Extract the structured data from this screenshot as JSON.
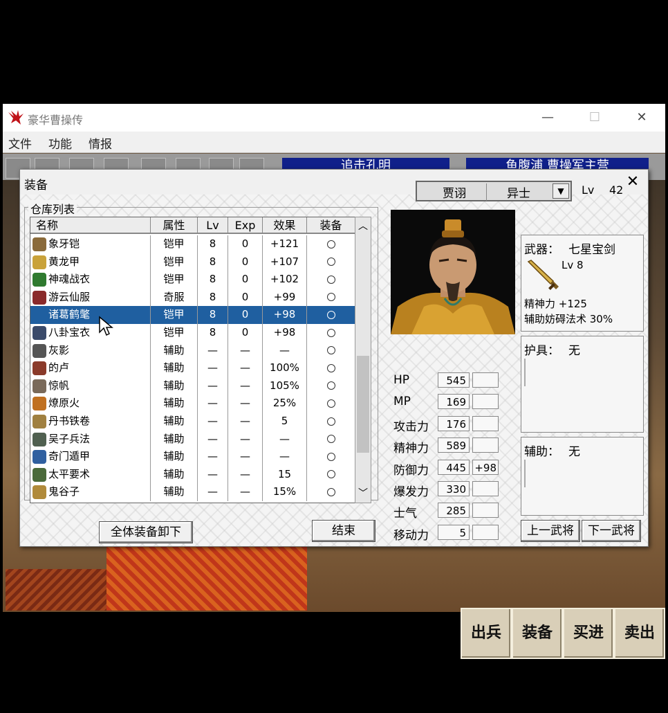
{
  "window": {
    "title": "豪华曹操传",
    "controls": [
      "—",
      "☐",
      "✕"
    ]
  },
  "menu": [
    "文件",
    "功能",
    "情报"
  ],
  "banners": [
    "追击孔明",
    "鱼腹浦 曹操军主营"
  ],
  "commands": [
    "出兵",
    "装备",
    "买进",
    "卖出"
  ],
  "dialog": {
    "title": "装备",
    "close": "✕",
    "warehouse_label": "仓库列表",
    "columns": [
      "名称",
      "属性",
      "Lv",
      "Exp",
      "效果",
      "装备"
    ],
    "items": [
      {
        "name": "象牙铠",
        "type": "铠甲",
        "lv": "8",
        "exp": "0",
        "effect": "+121",
        "equip": "○",
        "icon_color": "#8a6a3a"
      },
      {
        "name": "黄龙甲",
        "type": "铠甲",
        "lv": "8",
        "exp": "0",
        "effect": "+107",
        "equip": "○",
        "icon_color": "#c9a23a"
      },
      {
        "name": "神魂战衣",
        "type": "铠甲",
        "lv": "8",
        "exp": "0",
        "effect": "+102",
        "equip": "○",
        "icon_color": "#2f7a2f"
      },
      {
        "name": "游云仙服",
        "type": "奇服",
        "lv": "8",
        "exp": "0",
        "effect": "+99",
        "equip": "○",
        "icon_color": "#8a2a2a"
      },
      {
        "name": "诸葛鹤氅",
        "type": "铠甲",
        "lv": "8",
        "exp": "0",
        "effect": "+98",
        "equip": "○",
        "icon_color": "#b03030"
      },
      {
        "name": "八卦宝衣",
        "type": "铠甲",
        "lv": "8",
        "exp": "0",
        "effect": "+98",
        "equip": "○",
        "icon_color": "#3a4a6a"
      },
      {
        "name": "灰影",
        "type": "辅助",
        "lv": "—",
        "exp": "—",
        "effect": "—",
        "equip": "○",
        "icon_color": "#555555"
      },
      {
        "name": "的卢",
        "type": "辅助",
        "lv": "—",
        "exp": "—",
        "effect": "100%",
        "equip": "○",
        "icon_color": "#8a3a2a"
      },
      {
        "name": "惊帆",
        "type": "辅助",
        "lv": "—",
        "exp": "—",
        "effect": "105%",
        "equip": "○",
        "icon_color": "#7a6a5a"
      },
      {
        "name": "燎原火",
        "type": "辅助",
        "lv": "—",
        "exp": "—",
        "effect": "25%",
        "equip": "○",
        "icon_color": "#c07020"
      },
      {
        "name": "丹书铁卷",
        "type": "辅助",
        "lv": "—",
        "exp": "—",
        "effect": "5",
        "equip": "○",
        "icon_color": "#a08040"
      },
      {
        "name": "吴子兵法",
        "type": "辅助",
        "lv": "—",
        "exp": "—",
        "effect": "—",
        "equip": "○",
        "icon_color": "#506050"
      },
      {
        "name": "奇门遁甲",
        "type": "辅助",
        "lv": "—",
        "exp": "—",
        "effect": "—",
        "equip": "○",
        "icon_color": "#3060a0"
      },
      {
        "name": "太平要术",
        "type": "辅助",
        "lv": "—",
        "exp": "—",
        "effect": "15",
        "equip": "○",
        "icon_color": "#4a6a3a"
      },
      {
        "name": "鬼谷子",
        "type": "辅助",
        "lv": "—",
        "exp": "—",
        "effect": "15%",
        "equip": "○",
        "icon_color": "#b08a3a"
      }
    ],
    "selected_index": 4,
    "unequip_all": "全体装备卸下",
    "end": "结束",
    "character": {
      "name": "贾诩",
      "class": "异士",
      "dropdown": "▼",
      "lv_label": "Lv",
      "lv": "42",
      "stats": [
        {
          "label": "HP",
          "value": "545",
          "bonus": ""
        },
        {
          "label": "MP",
          "value": "169",
          "bonus": ""
        },
        {
          "label": "攻击力",
          "value": "176",
          "bonus": ""
        },
        {
          "label": "精神力",
          "value": "589",
          "bonus": ""
        },
        {
          "label": "防御力",
          "value": "445",
          "bonus": "+98"
        },
        {
          "label": "爆发力",
          "value": "330",
          "bonus": ""
        },
        {
          "label": "士气",
          "value": "285",
          "bonus": ""
        },
        {
          "label": "移动力",
          "value": "5",
          "bonus": ""
        }
      ]
    },
    "weapon": {
      "label": "武器：",
      "name": "七星宝剑",
      "lv": "Lv 8",
      "line1": "精神力 +125",
      "line2": "辅助妨碍法术 30%"
    },
    "armor": {
      "label": "护具：",
      "name": "无"
    },
    "assist": {
      "label": "辅助：",
      "name": "无"
    },
    "prev_general": "上一武将",
    "next_general": "下一武将"
  },
  "colors": {
    "selection": "#1f5fa0",
    "banner": "#10208a"
  }
}
